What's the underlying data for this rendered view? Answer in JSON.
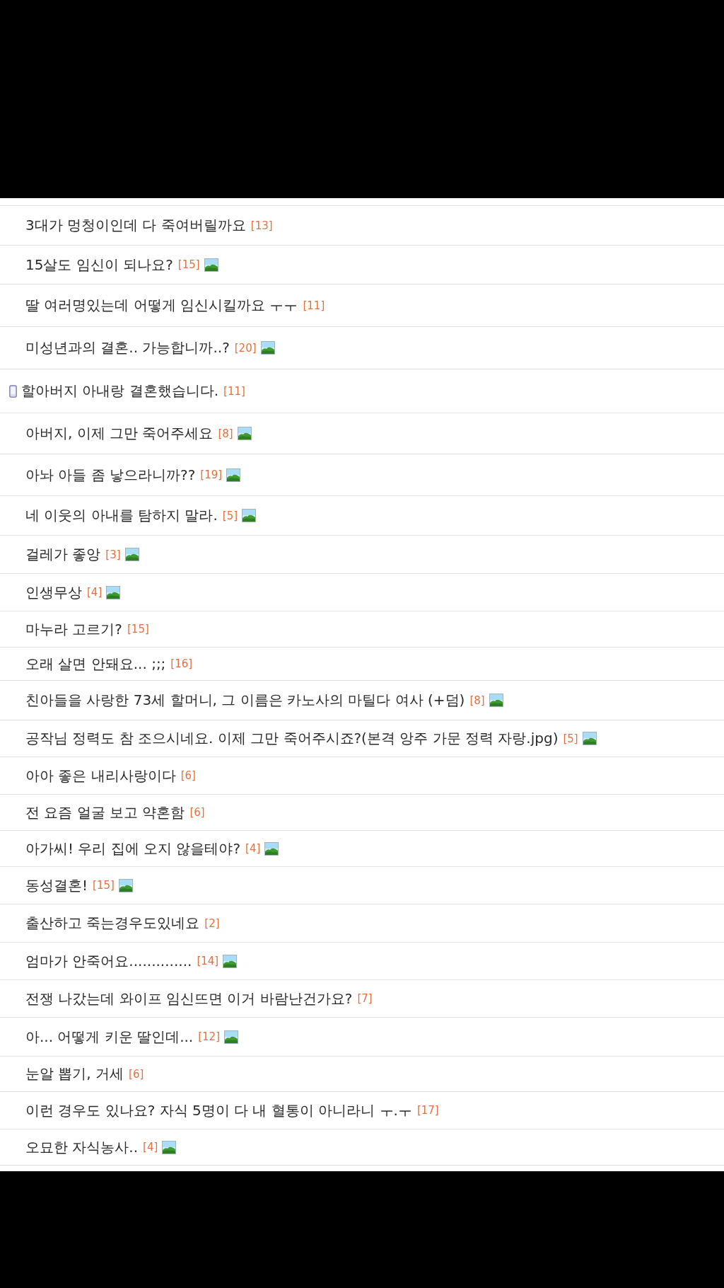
{
  "posts": [
    {
      "title": "3대가 멍청이인데 다 죽여버릴까요",
      "comments": "[13]",
      "has_image": false,
      "mobile": false
    },
    {
      "title": "15살도 임신이 되나요?",
      "comments": "[15]",
      "has_image": true,
      "mobile": false
    },
    {
      "title": "딸 여러명있는데 어떻게 임신시킬까요 ㅜㅜ",
      "comments": "[11]",
      "has_image": false,
      "mobile": false
    },
    {
      "title": "미성년과의 결혼.. 가능합니까..?",
      "comments": "[20]",
      "has_image": true,
      "mobile": false
    },
    {
      "title": "할아버지 아내랑 결혼했습니다.",
      "comments": "[11]",
      "has_image": false,
      "mobile": true
    },
    {
      "title": "아버지, 이제 그만 죽어주세요",
      "comments": "[8]",
      "has_image": true,
      "mobile": false
    },
    {
      "title": "아놔 아들 좀 낳으라니까??",
      "comments": "[19]",
      "has_image": true,
      "mobile": false
    },
    {
      "title": "네 이웃의 아내를 탐하지 말라.",
      "comments": "[5]",
      "has_image": true,
      "mobile": false
    },
    {
      "title": "걸레가 좋앙",
      "comments": "[3]",
      "has_image": true,
      "mobile": false
    },
    {
      "title": "인생무상",
      "comments": "[4]",
      "has_image": true,
      "mobile": false
    },
    {
      "title": "마누라 고르기?",
      "comments": "[15]",
      "has_image": false,
      "mobile": false
    },
    {
      "title": "오래 살면 안돼요... ;;;",
      "comments": "[16]",
      "has_image": false,
      "mobile": false
    },
    {
      "title": "친아들을 사랑한 73세 할머니, 그 이름은 카노사의 마틸다 여사 (+덤)",
      "comments": "[8]",
      "has_image": true,
      "mobile": false
    },
    {
      "title": "공작님 정력도 참 조으시네요. 이제 그만 죽어주시죠?(본격 앙주 가문 정력 자랑.jpg)",
      "comments": "[5]",
      "has_image": true,
      "mobile": false
    },
    {
      "title": "아아 좋은 내리사랑이다",
      "comments": "[6]",
      "has_image": false,
      "mobile": false
    },
    {
      "title": "전 요즘 얼굴 보고 약혼함",
      "comments": "[6]",
      "has_image": false,
      "mobile": false
    },
    {
      "title": "아가씨! 우리 집에 오지 않을테야?",
      "comments": "[4]",
      "has_image": true,
      "mobile": false
    },
    {
      "title": "동성결혼!",
      "comments": "[15]",
      "has_image": true,
      "mobile": false
    },
    {
      "title": "출산하고 죽는경우도있네요",
      "comments": "[2]",
      "has_image": false,
      "mobile": false
    },
    {
      "title": "엄마가 안죽어요..............",
      "comments": "[14]",
      "has_image": true,
      "mobile": false
    },
    {
      "title": "전쟁 나갔는데 와이프 임신뜨면 이거 바람난건가요?",
      "comments": "[7]",
      "has_image": false,
      "mobile": false
    },
    {
      "title": "아... 어떻게 키운 딸인데...",
      "comments": "[12]",
      "has_image": true,
      "mobile": false
    },
    {
      "title": "눈알 뽑기, 거세",
      "comments": "[6]",
      "has_image": false,
      "mobile": false
    },
    {
      "title": "이런 경우도 있나요? 자식 5명이 다 내 혈통이 아니라니 ㅜ.ㅜ",
      "comments": "[17]",
      "has_image": false,
      "mobile": false
    },
    {
      "title": "오묘한 자식농사..",
      "comments": "[4]",
      "has_image": true,
      "mobile": false
    }
  ]
}
